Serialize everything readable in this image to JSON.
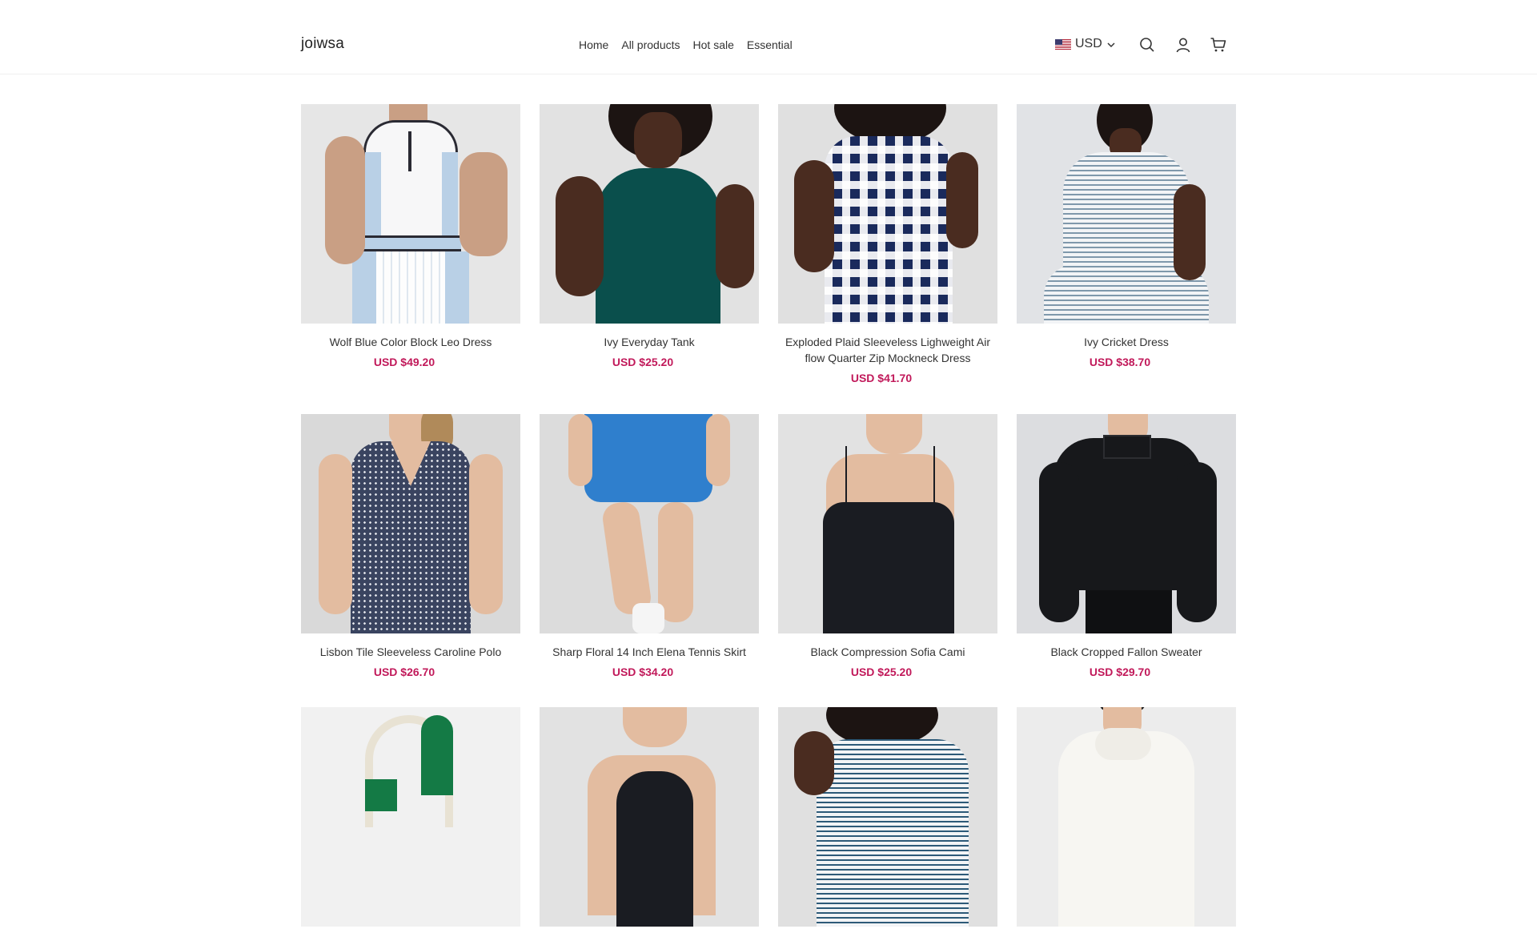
{
  "brand": {
    "logo": "joiwsa"
  },
  "nav": {
    "items": [
      "Home",
      "All products",
      "Hot sale",
      "Essential"
    ]
  },
  "header": {
    "currency": "USD",
    "icons": [
      "us-flag-icon",
      "chevron-down-icon",
      "search-icon",
      "user-icon",
      "cart-icon"
    ]
  },
  "colors": {
    "price": "#c1195a",
    "text": "#333333",
    "border": "#efefef"
  },
  "products": [
    {
      "title": "Wolf Blue Color Block Leo Dress",
      "price": "USD $49.20"
    },
    {
      "title": "Ivy Everyday Tank",
      "price": "USD $25.20"
    },
    {
      "title": "Exploded Plaid Sleeveless Lighweight Airflow Quarter Zip Mockneck Dress",
      "price": "USD $41.70"
    },
    {
      "title": "Ivy Cricket Dress",
      "price": "USD $38.70"
    },
    {
      "title": "Lisbon Tile Sleeveless Caroline Polo",
      "price": "USD $26.70"
    },
    {
      "title": "Sharp Floral 14 Inch Elena Tennis Skirt",
      "price": "USD $34.20"
    },
    {
      "title": "Black Compression Sofia Cami",
      "price": "USD $25.20"
    },
    {
      "title": "Black Cropped Fallon Sweater",
      "price": "USD $29.70"
    },
    {
      "title": "",
      "price": ""
    },
    {
      "title": "",
      "price": ""
    },
    {
      "title": "",
      "price": ""
    },
    {
      "title": "",
      "price": ""
    }
  ]
}
